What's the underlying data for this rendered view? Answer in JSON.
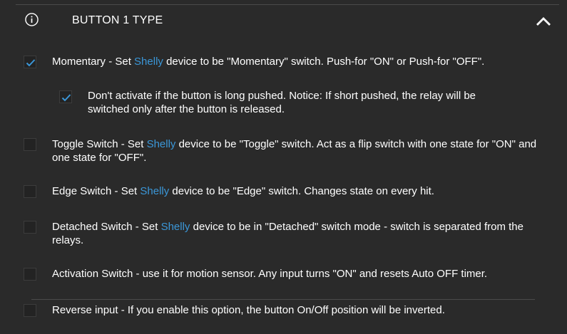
{
  "header": {
    "title": "BUTTON 1 TYPE"
  },
  "colors": {
    "background": "#2a2a2a",
    "brand": "#3b97d8",
    "check": "#3b97d8"
  },
  "options": [
    {
      "checked": true,
      "pre": "Momentary - Set ",
      "brand": "Shelly",
      "post": " device to be \"Momentary\" switch. Push-for \"ON\" or Push-for \"OFF\"."
    },
    {
      "checked": true,
      "text": "Don't activate if the button is long pushed. Notice: If short pushed, the relay will be switched only after the button is released."
    },
    {
      "checked": false,
      "pre": "Toggle Switch - Set ",
      "brand": "Shelly",
      "post": " device to be \"Toggle\" switch. Act as a flip switch with one state for \"ON\" and one state for \"OFF\"."
    },
    {
      "checked": false,
      "pre": "Edge Switch - Set ",
      "brand": "Shelly",
      "post": " device to be \"Edge\" switch. Changes state on every hit."
    },
    {
      "checked": false,
      "pre": "Detached Switch - Set ",
      "brand": "Shelly",
      "post": " device to be in \"Detached\" switch mode - switch is separated from the relays."
    },
    {
      "checked": false,
      "text": "Activation Switch - use it for motion sensor. Any input turns \"ON\" and resets Auto OFF timer."
    },
    {
      "checked": false,
      "text": "Reverse input - If you enable this option, the button On/Off position will be inverted."
    }
  ]
}
